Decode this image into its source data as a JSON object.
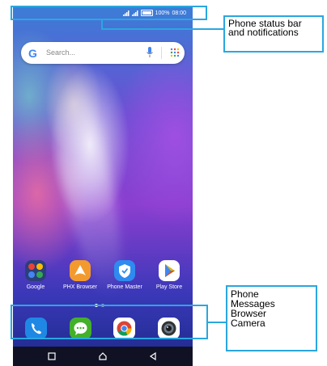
{
  "status_bar": {
    "battery": "100%",
    "time": "08:00"
  },
  "search": {
    "placeholder": "Search..."
  },
  "apps": [
    {
      "label": "Google",
      "icon": "google-folder-icon"
    },
    {
      "label": "PHX Browser",
      "icon": "phx-browser-icon"
    },
    {
      "label": "Phone Master",
      "icon": "phone-master-icon"
    },
    {
      "label": "Play Store",
      "icon": "play-store-icon"
    }
  ],
  "dock": [
    {
      "icon": "phone-icon"
    },
    {
      "icon": "messages-icon"
    },
    {
      "icon": "chrome-icon"
    },
    {
      "icon": "camera-icon"
    }
  ],
  "nav": [
    "square-icon",
    "home-icon",
    "back-icon"
  ],
  "annotations": {
    "status_callout": "Phone status bar and notifications",
    "dock_callout": [
      "Phone",
      "Messages",
      "Browser",
      "Camera"
    ]
  },
  "colors": {
    "accent": "#2aa7e0",
    "phone_blue": "#1f88e5",
    "messages_green": "#43b02a"
  }
}
